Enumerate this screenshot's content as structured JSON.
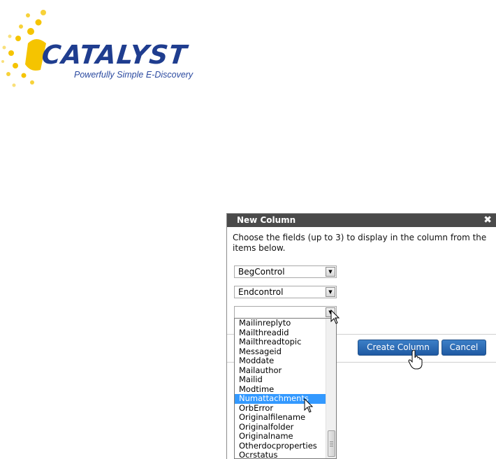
{
  "logo": {
    "wordmark": "CATALYST",
    "tagline": "Powerfully Simple E-Discovery"
  },
  "dialog": {
    "title": "New Column",
    "close_glyph": "✖",
    "instructions": "Choose the fields (up to 3) to display in the column from the items below.",
    "selects": [
      {
        "value": "BegControl"
      },
      {
        "value": "Endcontrol"
      },
      {
        "value": ""
      }
    ],
    "create_label": "Create Column",
    "cancel_label": "Cancel"
  },
  "dropdown": {
    "items": [
      "Mailinreplyto",
      "Mailthreadid",
      "Mailthreadtopic",
      "Messageid",
      "Moddate",
      "Mailauthor",
      "Mailid",
      "Modtime",
      "Numattachments",
      "OrbError",
      "Originalfilename",
      "Originalfolder",
      "Originalname",
      "Otherdocproperties",
      "Ocrstatus"
    ],
    "selected": "Numattachments"
  },
  "colors": {
    "titlebar": "#4a4a4a",
    "button": "#1f5aa3",
    "selection": "#3399ff",
    "logo_blue": "#1f3d8f",
    "logo_sun": "#f5c400"
  }
}
